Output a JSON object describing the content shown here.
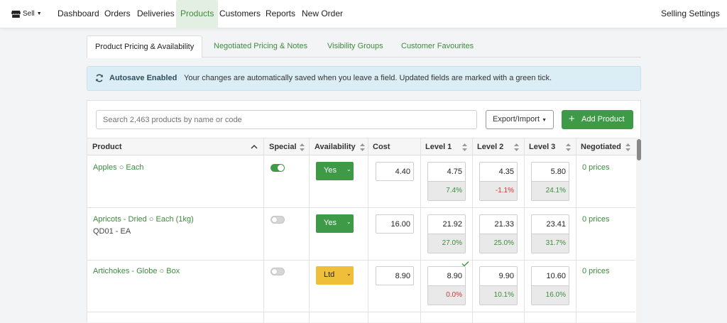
{
  "nav": {
    "sell": "Sell",
    "items": [
      "Dashboard",
      "Orders",
      "Deliveries",
      "Products",
      "Customers",
      "Reports",
      "New Order"
    ],
    "active": "Products",
    "settings": "Selling Settings"
  },
  "tabs": [
    "Product Pricing & Availability",
    "Negotiated Pricing & Notes",
    "Visibility Groups",
    "Customer Favourites"
  ],
  "banner": {
    "title": "Autosave Enabled",
    "message": "Your changes are automatically saved when you leave a field. Updated fields are marked with a green tick."
  },
  "toolbar": {
    "search_placeholder": "Search 2,463 products by name or code",
    "export_label": "Export/Import",
    "add_label": "Add Product"
  },
  "table": {
    "headers": [
      "Product",
      "Special",
      "Availability",
      "Cost",
      "Level 1",
      "Level 2",
      "Level 3",
      "Negotiated"
    ],
    "rows": [
      {
        "name": "Apples ○ Each",
        "code": "",
        "special": true,
        "availability": "Yes",
        "cost": "4.40",
        "levels": [
          {
            "value": "4.75",
            "margin": "7.4%"
          },
          {
            "value": "4.35",
            "margin": "-1.1%"
          },
          {
            "value": "5.80",
            "margin": "24.1%"
          }
        ],
        "negotiated": "0 prices"
      },
      {
        "name": "Apricots - Dried ○ Each (1kg)",
        "code": "QD01 - EA",
        "special": false,
        "availability": "Yes",
        "cost": "16.00",
        "levels": [
          {
            "value": "21.92",
            "margin": "27.0%"
          },
          {
            "value": "21.33",
            "margin": "25.0%"
          },
          {
            "value": "23.41",
            "margin": "31.7%"
          }
        ],
        "negotiated": "0 prices"
      },
      {
        "name": "Artichokes - Globe ○ Box",
        "code": "",
        "special": false,
        "availability": "Ltd",
        "cost": "8.90",
        "levels": [
          {
            "value": "8.90",
            "margin": "0.0%"
          },
          {
            "value": "9.90",
            "margin": "10.1%"
          },
          {
            "value": "10.60",
            "margin": "16.0%"
          }
        ],
        "negotiated": "0 prices"
      }
    ]
  },
  "colors": {
    "accent": "#3f9a48",
    "link": "#3c8c3c",
    "negative": "#d0343a",
    "ltd": "#f0bf3a",
    "banner": "#dceef5"
  }
}
